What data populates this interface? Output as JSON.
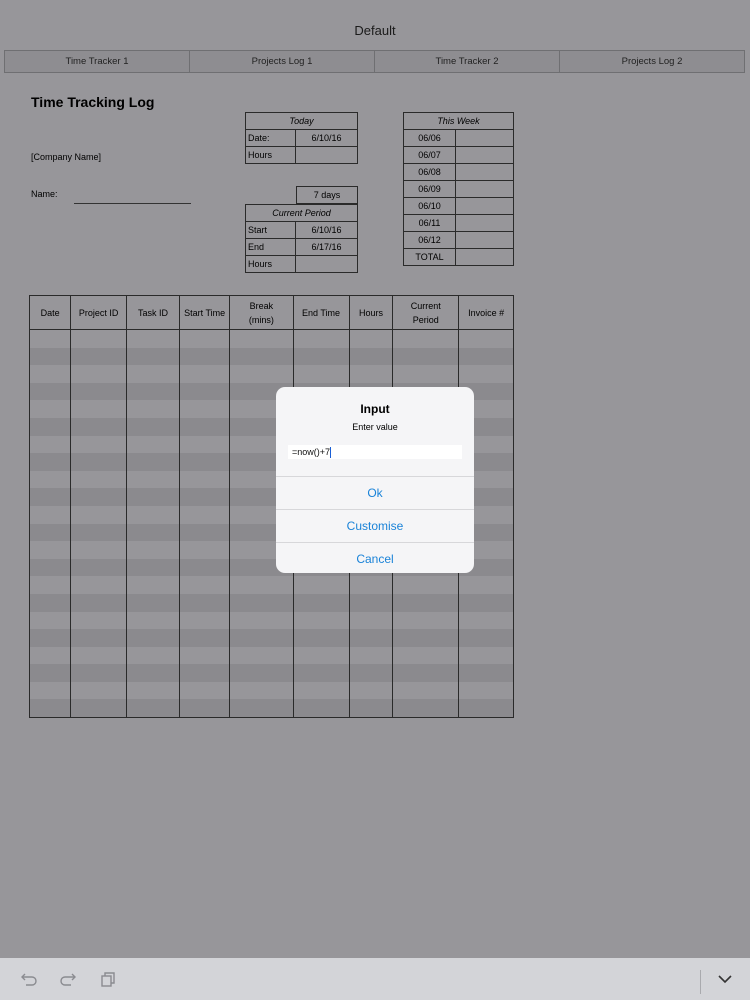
{
  "window": {
    "title": "Default"
  },
  "tabs": [
    "Time Tracker 1",
    "Projects Log 1",
    "Time Tracker 2",
    "Projects Log 2"
  ],
  "sheet": {
    "title": "Time Tracking Log",
    "company": "[Company Name]",
    "name_label": "Name:"
  },
  "today": {
    "header": "Today",
    "date_label": "Date:",
    "date_value": "6/10/16",
    "hours_label": "Hours",
    "hours_value": ""
  },
  "days": "7 days",
  "period": {
    "header": "Current Period",
    "start_label": "Start",
    "start_value": "6/10/16",
    "end_label": "End",
    "end_value": "6/17/16",
    "hours_label": "Hours"
  },
  "week": {
    "header": "This Week",
    "days": [
      "06/06",
      "06/07",
      "06/08",
      "06/09",
      "06/10",
      "06/11",
      "06/12"
    ],
    "total_label": "TOTAL"
  },
  "log": {
    "columns": [
      "Date",
      "Project ID",
      "Task ID",
      "Start Time",
      "Break (mins)",
      "End Time",
      "Hours",
      "Current Period",
      "Invoice #"
    ]
  },
  "dialog": {
    "title": "Input",
    "message": "Enter value",
    "value": "=now()+7",
    "ok": "Ok",
    "customise": "Customise",
    "cancel": "Cancel"
  },
  "toolbar": {
    "icons": [
      "undo-icon",
      "redo-icon",
      "copy-icon",
      "chevron-down-icon"
    ]
  }
}
